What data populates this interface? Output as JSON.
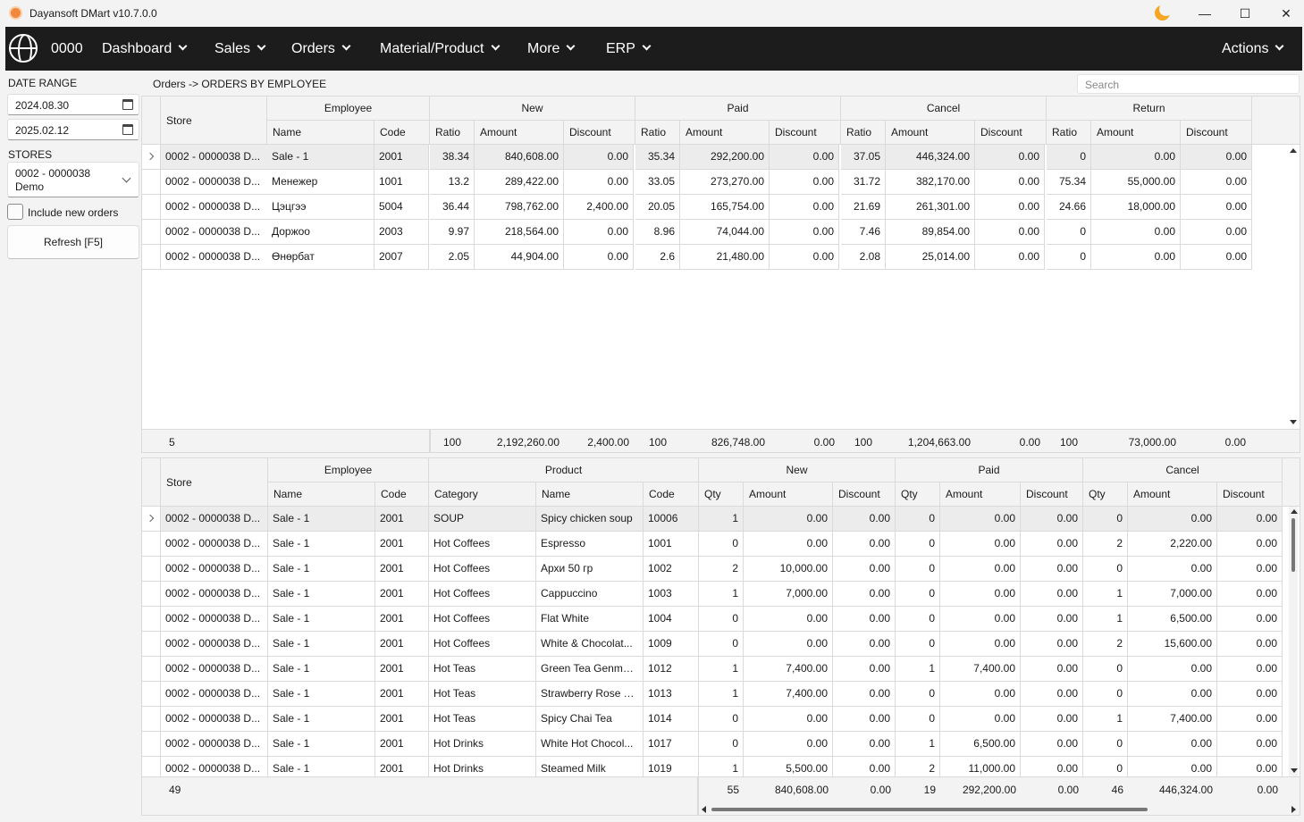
{
  "window": {
    "title": "Dayansoft DMart v10.7.0.0",
    "min": "—",
    "max": "☐",
    "close": "✕"
  },
  "nav": {
    "store": "0000",
    "items": [
      {
        "label": "Dashboard"
      },
      {
        "label": "Sales"
      },
      {
        "label": "Orders"
      },
      {
        "label": "Material/Product"
      },
      {
        "label": "More"
      },
      {
        "label": "ERP"
      }
    ],
    "actions": "Actions"
  },
  "filters": {
    "date_range_label": "DATE RANGE",
    "date_from": "2024.08.30",
    "date_to": "2025.02.12",
    "stores_label": "STORES",
    "store_line1": "0002 - 0000038",
    "store_line2": "Demo",
    "include_new": "Include new orders",
    "refresh": "Refresh [F5]"
  },
  "breadcrumb": "Orders -> ORDERS BY EMPLOYEE",
  "search": {
    "placeholder": "Search"
  },
  "grid1": {
    "headers": {
      "store": "Store",
      "employee": "Employee",
      "name": "Name",
      "code": "Code",
      "new": "New",
      "paid": "Paid",
      "cancel": "Cancel",
      "return": "Return",
      "ratio": "Ratio",
      "amount": "Amount",
      "discount": "Discount"
    },
    "rows": [
      [
        "0002 - 0000038 D...",
        "Sale - 1",
        "2001",
        "38.34",
        "840,608.00",
        "0.00",
        "35.34",
        "292,200.00",
        "0.00",
        "37.05",
        "446,324.00",
        "0.00",
        "0",
        "0.00",
        "0.00"
      ],
      [
        "0002 - 0000038 D...",
        "Менежер",
        "1001",
        "13.2",
        "289,422.00",
        "0.00",
        "33.05",
        "273,270.00",
        "0.00",
        "31.72",
        "382,170.00",
        "0.00",
        "75.34",
        "55,000.00",
        "0.00"
      ],
      [
        "0002 - 0000038 D...",
        "Цэцгээ",
        "5004",
        "36.44",
        "798,762.00",
        "2,400.00",
        "20.05",
        "165,754.00",
        "0.00",
        "21.69",
        "261,301.00",
        "0.00",
        "24.66",
        "18,000.00",
        "0.00"
      ],
      [
        "0002 - 0000038 D...",
        "Доржоо",
        "2003",
        "9.97",
        "218,564.00",
        "0.00",
        "8.96",
        "74,044.00",
        "0.00",
        "7.46",
        "89,854.00",
        "0.00",
        "0",
        "0.00",
        "0.00"
      ],
      [
        "0002 - 0000038 D...",
        "Өнөрбат",
        "2007",
        "2.05",
        "44,904.00",
        "0.00",
        "2.6",
        "21,480.00",
        "0.00",
        "2.08",
        "25,014.00",
        "0.00",
        "0",
        "0.00",
        "0.00"
      ]
    ],
    "totals": {
      "count": "5",
      "new_ratio": "100",
      "new_amount": "2,192,260.00",
      "new_discount": "2,400.00",
      "paid_ratio": "100",
      "paid_amount": "826,748.00",
      "paid_discount": "0.00",
      "cancel_ratio": "100",
      "cancel_amount": "1,204,663.00",
      "cancel_discount": "0.00",
      "return_ratio": "100",
      "return_amount": "73,000.00",
      "return_discount": "0.00"
    }
  },
  "grid2": {
    "headers": {
      "store": "Store",
      "employee": "Employee",
      "product": "Product",
      "name": "Name",
      "code": "Code",
      "category": "Category",
      "new": "New",
      "paid": "Paid",
      "cancel": "Cancel",
      "qty": "Qty",
      "amount": "Amount",
      "discount": "Discount"
    },
    "rows": [
      [
        "0002 - 0000038 D...",
        "Sale - 1",
        "2001",
        "SOUP",
        "Spicy chicken soup",
        "10006",
        "1",
        "0.00",
        "0.00",
        "0",
        "0.00",
        "0.00",
        "0",
        "0.00",
        "0.00"
      ],
      [
        "0002 - 0000038 D...",
        "Sale - 1",
        "2001",
        "Hot Coffees",
        "Espresso",
        "1001",
        "0",
        "0.00",
        "0.00",
        "0",
        "0.00",
        "0.00",
        "2",
        "2,220.00",
        "0.00"
      ],
      [
        "0002 - 0000038 D...",
        "Sale - 1",
        "2001",
        "Hot Coffees",
        "Архи 50 гр",
        "1002",
        "2",
        "10,000.00",
        "0.00",
        "0",
        "0.00",
        "0.00",
        "0",
        "0.00",
        "0.00"
      ],
      [
        "0002 - 0000038 D...",
        "Sale - 1",
        "2001",
        "Hot Coffees",
        "Cappuccino",
        "1003",
        "1",
        "7,000.00",
        "0.00",
        "0",
        "0.00",
        "0.00",
        "1",
        "7,000.00",
        "0.00"
      ],
      [
        "0002 - 0000038 D...",
        "Sale - 1",
        "2001",
        "Hot Coffees",
        "Flat White",
        "1004",
        "0",
        "0.00",
        "0.00",
        "0",
        "0.00",
        "0.00",
        "1",
        "6,500.00",
        "0.00"
      ],
      [
        "0002 - 0000038 D...",
        "Sale - 1",
        "2001",
        "Hot Coffees",
        "White & Chocolat...",
        "1009",
        "0",
        "0.00",
        "0.00",
        "0",
        "0.00",
        "0.00",
        "2",
        "15,600.00",
        "0.00"
      ],
      [
        "0002 - 0000038 D...",
        "Sale - 1",
        "2001",
        "Hot Teas",
        "Green Tea Genmai...",
        "1012",
        "1",
        "7,400.00",
        "0.00",
        "1",
        "7,400.00",
        "0.00",
        "0",
        "0.00",
        "0.00"
      ],
      [
        "0002 - 0000038 D...",
        "Sale - 1",
        "2001",
        "Hot Teas",
        "Strawberry Rose Tea",
        "1013",
        "1",
        "7,400.00",
        "0.00",
        "0",
        "0.00",
        "0.00",
        "0",
        "0.00",
        "0.00"
      ],
      [
        "0002 - 0000038 D...",
        "Sale - 1",
        "2001",
        "Hot Teas",
        "Spicy Chai Tea",
        "1014",
        "0",
        "0.00",
        "0.00",
        "0",
        "0.00",
        "0.00",
        "1",
        "7,400.00",
        "0.00"
      ],
      [
        "0002 - 0000038 D...",
        "Sale - 1",
        "2001",
        "Hot Drinks",
        "White Hot Chocol...",
        "1017",
        "0",
        "0.00",
        "0.00",
        "1",
        "6,500.00",
        "0.00",
        "0",
        "0.00",
        "0.00"
      ],
      [
        "0002 - 0000038 D...",
        "Sale - 1",
        "2001",
        "Hot Drinks",
        "Steamed Milk",
        "1019",
        "1",
        "5,500.00",
        "0.00",
        "2",
        "11,000.00",
        "0.00",
        "0",
        "0.00",
        "0.00"
      ]
    ],
    "totals": {
      "count": "49",
      "new_qty": "55",
      "new_amount": "840,608.00",
      "new_discount": "0.00",
      "paid_qty": "19",
      "paid_amount": "292,200.00",
      "paid_discount": "0.00",
      "cancel_qty": "46",
      "cancel_amount": "446,324.00",
      "cancel_discount": "0.00"
    }
  }
}
